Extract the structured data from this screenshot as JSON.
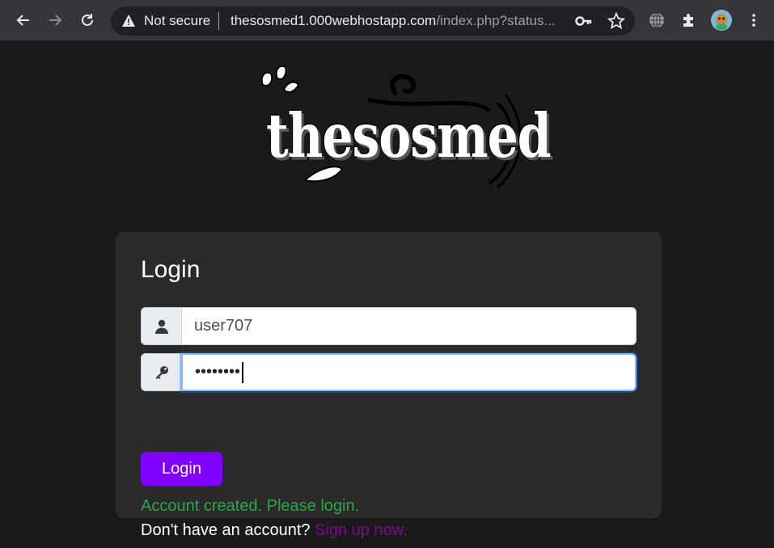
{
  "browser": {
    "security_label": "Not secure",
    "url_host": "thesosmed1.000webhostapp.com",
    "url_path": "/index.php?status..."
  },
  "logo": {
    "text": "thesosmed"
  },
  "login_form": {
    "title": "Login",
    "username_value": "user707",
    "password_masked": "••••••••",
    "submit_label": "Login",
    "status_message": "Account created. Please login.",
    "signup_prompt": "Don't have an account?",
    "signup_link": "Sign up now."
  },
  "colors": {
    "accent": "#8000ff",
    "success": "#28a745",
    "link": "#7a0a8a"
  }
}
